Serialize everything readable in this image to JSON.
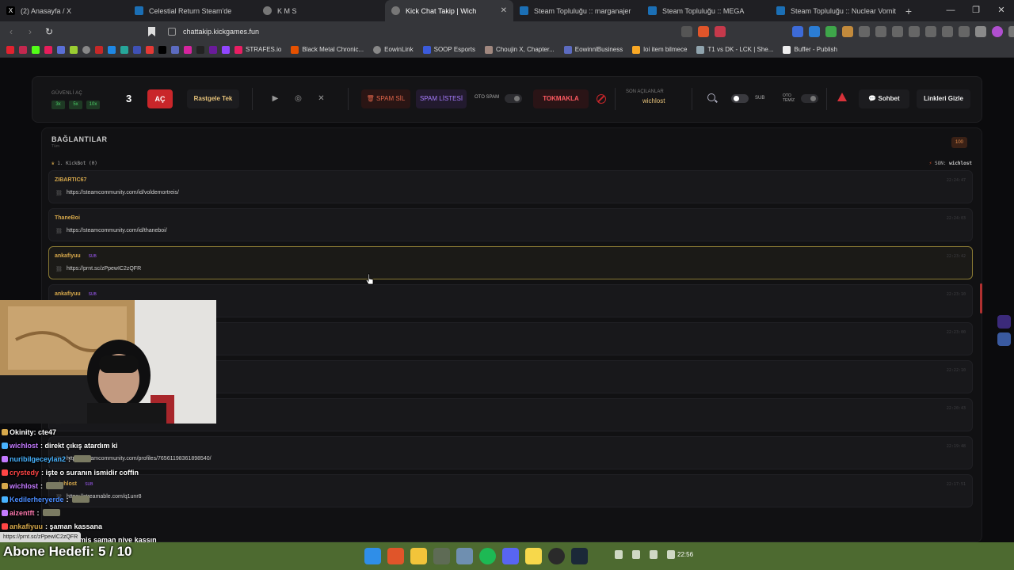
{
  "browser": {
    "tabs": [
      {
        "title": "(2) Anasayfa / X",
        "icon": "x-logo-icon",
        "color": "#000000"
      },
      {
        "title": "Celestial Return Steam'de",
        "icon": "steam-icon",
        "color": "#1b6fb5"
      },
      {
        "title": "K M S",
        "icon": "globe-icon",
        "color": "#777777"
      },
      {
        "title": "Kick Chat Takip | Wich",
        "icon": "globe-icon",
        "color": "#777777",
        "active": true
      },
      {
        "title": "Steam Topluluğu :: marganajer",
        "icon": "steam-icon",
        "color": "#1b6fb5"
      },
      {
        "title": "Steam Topluluğu :: MEGA",
        "icon": "steam-icon",
        "color": "#1b6fb5"
      },
      {
        "title": "Steam Topluluğu :: Nuclear Vomit",
        "icon": "steam-icon",
        "color": "#1b6fb5"
      }
    ],
    "url": "chattakip.kickgames.fun",
    "bookmarks": [
      "STRAFES.io",
      "Black Metal Chronic...",
      "EowinLink",
      "SOOP Esports",
      "Choujin X, Chapter...",
      "EowinnlBusiness",
      "loi item bilmece",
      "T1 vs DK - LCK | She...",
      "Buffer - Publish"
    ]
  },
  "toolbar": {
    "guvenli_label": "GÜVENLİ AÇ",
    "multipliers": [
      "3x",
      "5x",
      "10x"
    ],
    "count": "3",
    "ac_label": "AÇ",
    "random_label": "Rastgele Tek",
    "spam_sil_label": "SPAM SİL",
    "spam_list_label": "SPAM LİSTESİ",
    "oto_spam_label": "OTO SPAM",
    "tokmakla_label": "TOKMAKLA",
    "son_label": "SON AÇILANLAR",
    "son_user": "wichlost",
    "sub_label": "SUB",
    "oto_temiz_label": "OTO TEMİZ",
    "sohbet_label": "Sohbet",
    "gizle_label": "Linkleri Gizle"
  },
  "panel": {
    "title": "BAĞLANTILAR",
    "subtitle": "Tüm",
    "badge": "100",
    "meta_left": "1. KickBot (0)",
    "meta_right_label": "SON:",
    "meta_right_user": "wichlost"
  },
  "links": [
    {
      "user": "ZIBARTIC67",
      "sub": false,
      "url": "https://steamcommunity.com/id/voldemortreis/",
      "time": "22:24:47"
    },
    {
      "user": "ThaneBoi",
      "sub": false,
      "url": "https://steamcommunity.com/id/thaneboi/",
      "time": "22:24:03"
    },
    {
      "user": "ankafiyuu",
      "sub": true,
      "url": "https://prnt.sc/zPpewIC2zQFR",
      "time": "22:23:42",
      "selected": true
    },
    {
      "user": "ankafiyuu",
      "sub": true,
      "url": "",
      "time": "22:23:10"
    },
    {
      "user": "",
      "sub": false,
      "url": "",
      "time": "22:23:00"
    },
    {
      "user": "",
      "sub": false,
      "url": "",
      "time": "22:22:10"
    },
    {
      "user": "",
      "sub": false,
      "url": "https://steamcommunity.com/id/2OME27",
      "time": "22:20:43"
    },
    {
      "user": "",
      "sub": false,
      "url": "https://steamcommunity.com/profiles/76561198361898540/",
      "time": "22:19:48"
    },
    {
      "user": "wichlost",
      "sub": true,
      "url": "https://streamable.com/q1unr8",
      "time": "22:17:51"
    }
  ],
  "sub_badge_text": "SUB",
  "chat_overlay": [
    {
      "user": "Okinity: cte47",
      "color": "#ffffff",
      "msg": ""
    },
    {
      "user": "wichlost",
      "color": "#c47aff",
      "msg": ": direkt çıkış atardım ki"
    },
    {
      "user": "nuribilgeceylan2",
      "color": "#48b3ff",
      "msg": ":"
    },
    {
      "user": "crystedy",
      "color": "#ff4545",
      "msg": ": işte o suranın ismidir coffin"
    },
    {
      "user": "wichlost",
      "color": "#c47aff",
      "msg": ":"
    },
    {
      "user": "Kedilerheryerde",
      "color": "#4a8cff",
      "msg": ":"
    },
    {
      "user": "aizentft",
      "color": "#ff7ab0",
      "msg": ":"
    },
    {
      "user": "ankafiyuu",
      "color": "#d6a84b",
      "msg": ": şaman kassana"
    },
    {
      "user": "wichlost",
      "color": "#c47aff",
      "msg": ": deli mi sikmis saman niye kassın"
    }
  ],
  "status_url": "https://prnt.sc/zPpewIC2zQFR",
  "abone": {
    "label": "Abone Hedefi:",
    "value": "5 / 10"
  },
  "clock": "22:56",
  "colors": {
    "accent": "#d6a84b",
    "danger": "#c9262a",
    "sub": "#a35cff"
  }
}
